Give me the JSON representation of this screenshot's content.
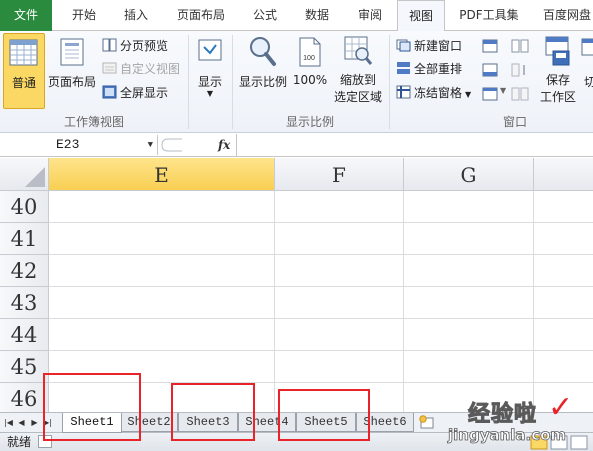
{
  "menu": {
    "tabs": [
      {
        "id": "file",
        "label": "文件",
        "active": false
      },
      {
        "id": "home",
        "label": "开始",
        "active": false
      },
      {
        "id": "insert",
        "label": "插入",
        "active": false
      },
      {
        "id": "page_layout",
        "label": "页面布局",
        "active": false
      },
      {
        "id": "formulas",
        "label": "公式",
        "active": false
      },
      {
        "id": "data",
        "label": "数据",
        "active": false
      },
      {
        "id": "review",
        "label": "审阅",
        "active": false
      },
      {
        "id": "view",
        "label": "视图",
        "active": true
      },
      {
        "id": "pdf",
        "label": "PDF工具集",
        "active": false
      },
      {
        "id": "baidu",
        "label": "百度网盘",
        "active": false
      }
    ]
  },
  "ribbon": {
    "workbook_views": {
      "group_label": "工作簿视图",
      "normal": "普通",
      "page_layout": "页面布局",
      "page_break_preview": "分页预览",
      "custom_views": "自定义视图",
      "full_screen": "全屏显示"
    },
    "show": {
      "label": "显示"
    },
    "zoom": {
      "group_label": "显示比例",
      "zoom": "显示比例",
      "hundred": "100%",
      "zoom_to_selection_1": "缩放到",
      "zoom_to_selection_2": "选定区域"
    },
    "window": {
      "group_label": "窗口",
      "new_window": "新建窗口",
      "arrange_all": "全部重排",
      "freeze_panes": "冻结窗格",
      "save_workspace_1": "保存",
      "save_workspace_2": "工作区",
      "switch": "切"
    }
  },
  "formula_bar": {
    "name_box": "E23",
    "fx": "fx"
  },
  "grid": {
    "columns": [
      "E",
      "F",
      "G"
    ],
    "selected_column": "E",
    "rows": [
      "40",
      "41",
      "42",
      "43",
      "44",
      "45",
      "46"
    ]
  },
  "sheets": {
    "tabs": [
      "Sheet1",
      "Sheet2",
      "Sheet3",
      "Sheet4",
      "Sheet5",
      "Sheet6"
    ],
    "active": "Sheet1"
  },
  "status": {
    "text": "就绪"
  },
  "watermark": {
    "title": "经验啦",
    "check": "✓",
    "domain": "jingyanla.com"
  },
  "colors": {
    "accent": "#2a8a3e",
    "selected": "#fbd864",
    "annotation": "#e8232a"
  }
}
